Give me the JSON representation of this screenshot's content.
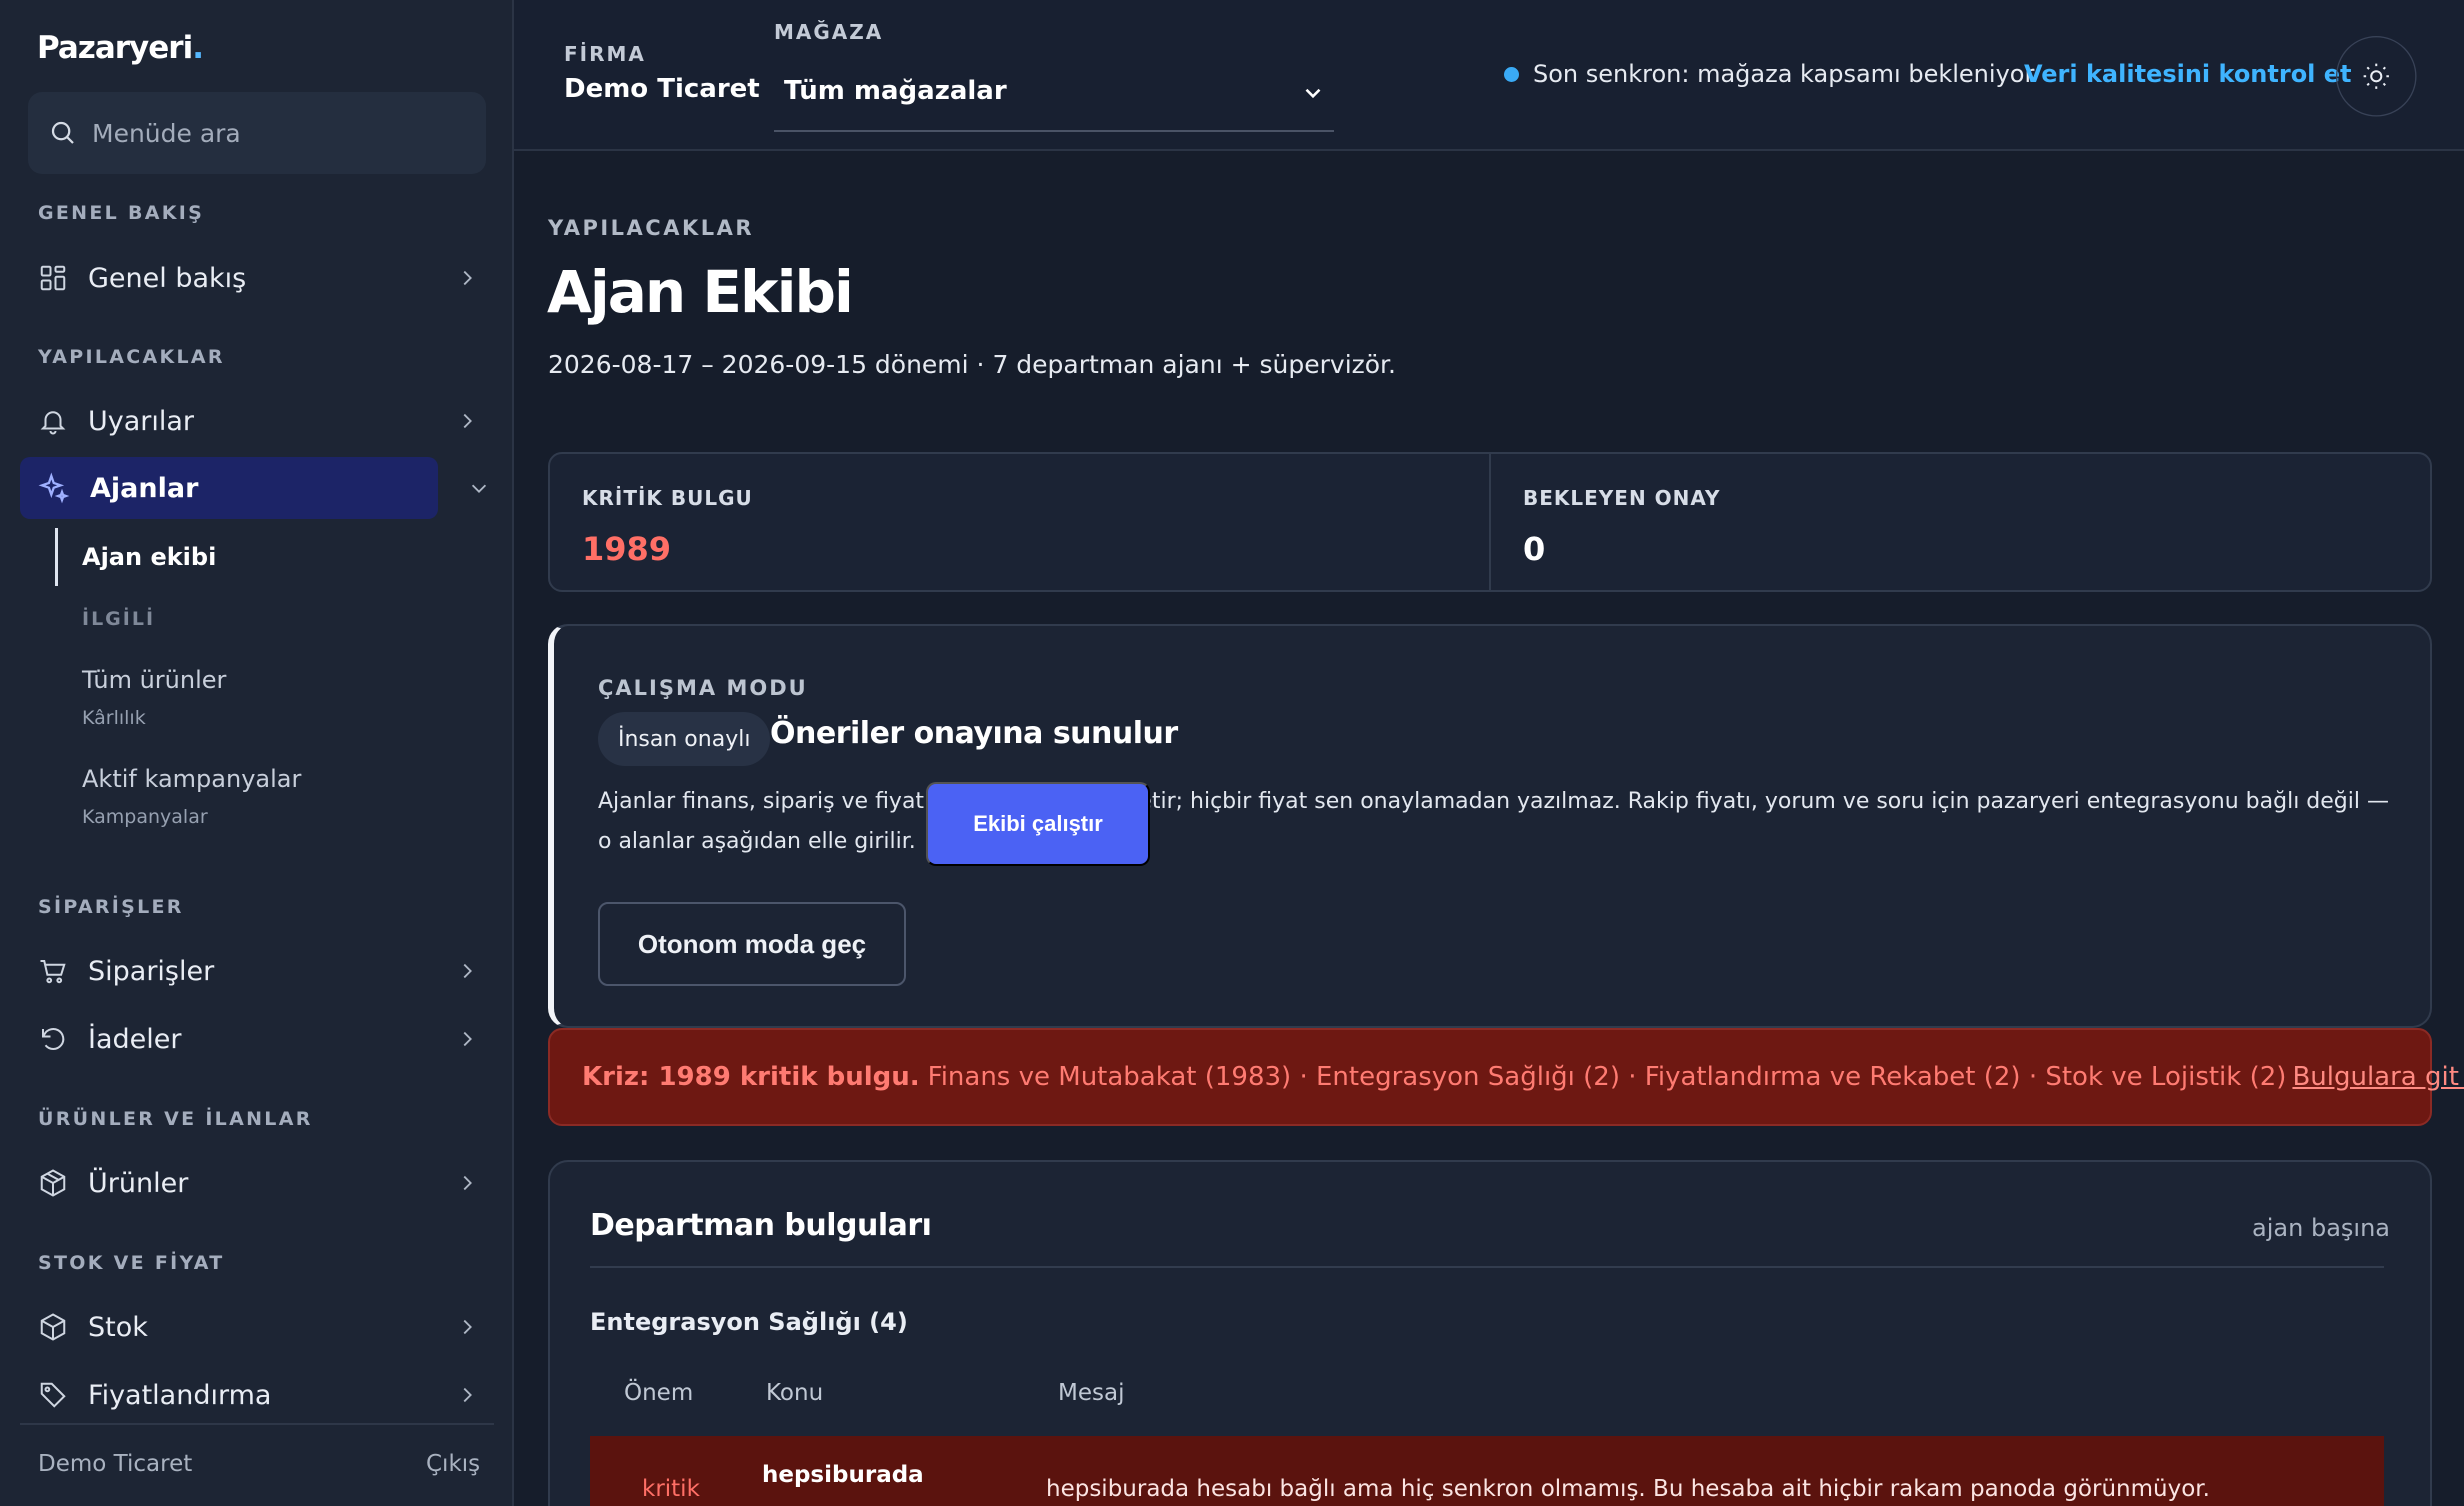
{
  "brand": {
    "name": "Pazaryeri",
    "dot": "."
  },
  "search": {
    "placeholder": "Menüde ara"
  },
  "sidebar": {
    "sections": {
      "overview": "GENEL BAKIŞ",
      "todos": "YAPILACAKLAR",
      "orders": "SİPARİŞLER",
      "products": "ÜRÜNLER VE İLANLAR",
      "stock": "STOK VE FİYAT"
    },
    "items": {
      "overview": "Genel bakış",
      "alerts": "Uyarılar",
      "agents": "Ajanlar",
      "orders": "Siparişler",
      "returns": "İadeler",
      "products": "Ürünler",
      "stock": "Stok",
      "pricing": "Fiyatlandırma"
    },
    "sub": {
      "team": "Ajan ekibi",
      "related": "İLGİLİ",
      "all_products": "Tüm ürünler",
      "all_products_sub": "Kârlılık",
      "campaigns": "Aktif kampanyalar",
      "campaigns_sub": "Kampanyalar"
    },
    "footer": {
      "company": "Demo Ticaret",
      "logout": "Çıkış"
    }
  },
  "topbar": {
    "company_label": "FİRMA",
    "company_value": "Demo Ticaret",
    "store_label": "MAĞAZA",
    "store_value": "Tüm mağazalar",
    "sync_text": "Son senkron: mağaza kapsamı bekleniyor",
    "quality_link": "Veri kalitesini kontrol et"
  },
  "page": {
    "eyebrow": "YAPILACAKLAR",
    "title": "Ajan Ekibi",
    "subtitle": "2026-08-17 – 2026-09-15 dönemi · 7 departman ajanı + süpervizör."
  },
  "stats": [
    {
      "label": "KRİTİK BULGU",
      "value": "1989"
    },
    {
      "label": "BEKLEYEN ONAY",
      "value": "0"
    }
  ],
  "mode": {
    "label": "ÇALIŞMA MODU",
    "pill": "İnsan onaylı",
    "heading": "Öneriler onayına sunulur",
    "body": "Ajanlar finans, sipariş ve fiyat verisinden öneri üretir; hiçbir fiyat sen onaylamadan yazılmaz. Rakip fiyatı, yorum ve soru için pazaryeri entegrasyonu bağlı değil — o alanlar aşağıdan elle girilir.",
    "autonomous_btn": "Otonom moda geç",
    "run_btn": "Ekibi çalıştır"
  },
  "crisis": {
    "prefix": "Kriz: 1989 kritik bulgu.",
    "detail": "Finans ve Mutabakat (1983) · Entegrasyon Sağlığı (2) · Fiyatlandırma ve Rekabet (2) · Stok ve Lojistik (2)",
    "link": "Bulgulara git →"
  },
  "findings": {
    "title": "Departman bulguları",
    "right": "ajan başına",
    "group": "Entegrasyon Sağlığı (4)",
    "columns": [
      "Önem",
      "Konu",
      "Mesaj"
    ],
    "rows": [
      {
        "severity": "kritik",
        "topic": "hepsiburada",
        "message": "hepsiburada hesabı bağlı ama hiç senkron olmamış. Bu hesaba ait hiçbir rakam panoda görünmüyor."
      }
    ]
  },
  "colors": {
    "accent": "#4b62f4",
    "critical": "#ff6f66",
    "link": "#3fb4ff",
    "active_nav": "#1c2467",
    "crisis_bg": "#6e1812"
  }
}
